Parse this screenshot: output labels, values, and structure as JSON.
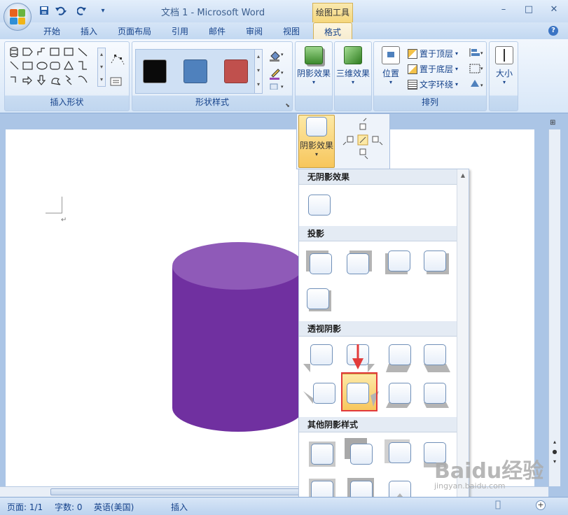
{
  "window": {
    "title": "文档 1 - Microsoft Word",
    "context_group": "绘图工具",
    "controls": [
      "–",
      "□",
      "✕"
    ]
  },
  "qat": {
    "save_icon": "save-icon",
    "undo_icon": "undo-icon",
    "redo_icon": "redo-icon"
  },
  "tabs": [
    "开始",
    "插入",
    "页面布局",
    "引用",
    "邮件",
    "审阅",
    "视图",
    "格式"
  ],
  "active_tab": "格式",
  "ribbon": {
    "insert_shapes": {
      "label": "插入形状"
    },
    "shape_styles": {
      "label": "形状样式",
      "swatches": [
        "#0a0a0a",
        "#4f81bd",
        "#c0504d"
      ]
    },
    "shadow": {
      "label": "阴影效果"
    },
    "three_d": {
      "label": "三维效果"
    },
    "arrange": {
      "label": "排列",
      "position": "位置",
      "bring_front": "置于顶层",
      "send_back": "置于底层",
      "text_wrap": "文字环绕"
    },
    "size": {
      "label": "大小"
    }
  },
  "shadow_dropdown": {
    "button_label": "阴影效果",
    "sections": {
      "none": "无阴影效果",
      "drop": "投影",
      "perspective": "透视阴影",
      "other": "其他阴影样式"
    },
    "selected_index": 5
  },
  "shape_color": "#7030a0",
  "status": {
    "page": "页面: 1/1",
    "words": "字数: 0",
    "language": "英语(美国)",
    "mode": "插入"
  },
  "watermark": {
    "brand": "Baidu经验",
    "url": "jingyan.baidu.com"
  }
}
